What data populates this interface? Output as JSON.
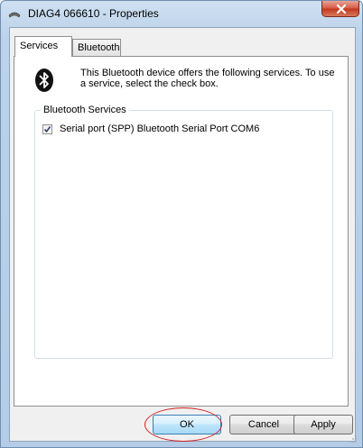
{
  "window": {
    "title": "DIAG4 066610 - Properties"
  },
  "tabs": [
    {
      "label": "Services",
      "active": true
    },
    {
      "label": "Bluetooth",
      "active": false
    }
  ],
  "panel": {
    "description": "This Bluetooth device offers the following services. To use a service, select the check box.",
    "group_label": "Bluetooth Services",
    "services": [
      {
        "label": "Serial port (SPP) Bluetooth Serial Port  COM6",
        "checked": true
      }
    ]
  },
  "buttons": {
    "ok": "OK",
    "cancel": "Cancel",
    "apply": "Apply"
  },
  "icons": {
    "title": "device-icon",
    "panel": "bluetooth-icon",
    "close": "close-icon"
  },
  "colors": {
    "highlight": "#d42424",
    "title_bar": "#bcd2ea",
    "close_button": "#c2361b"
  }
}
